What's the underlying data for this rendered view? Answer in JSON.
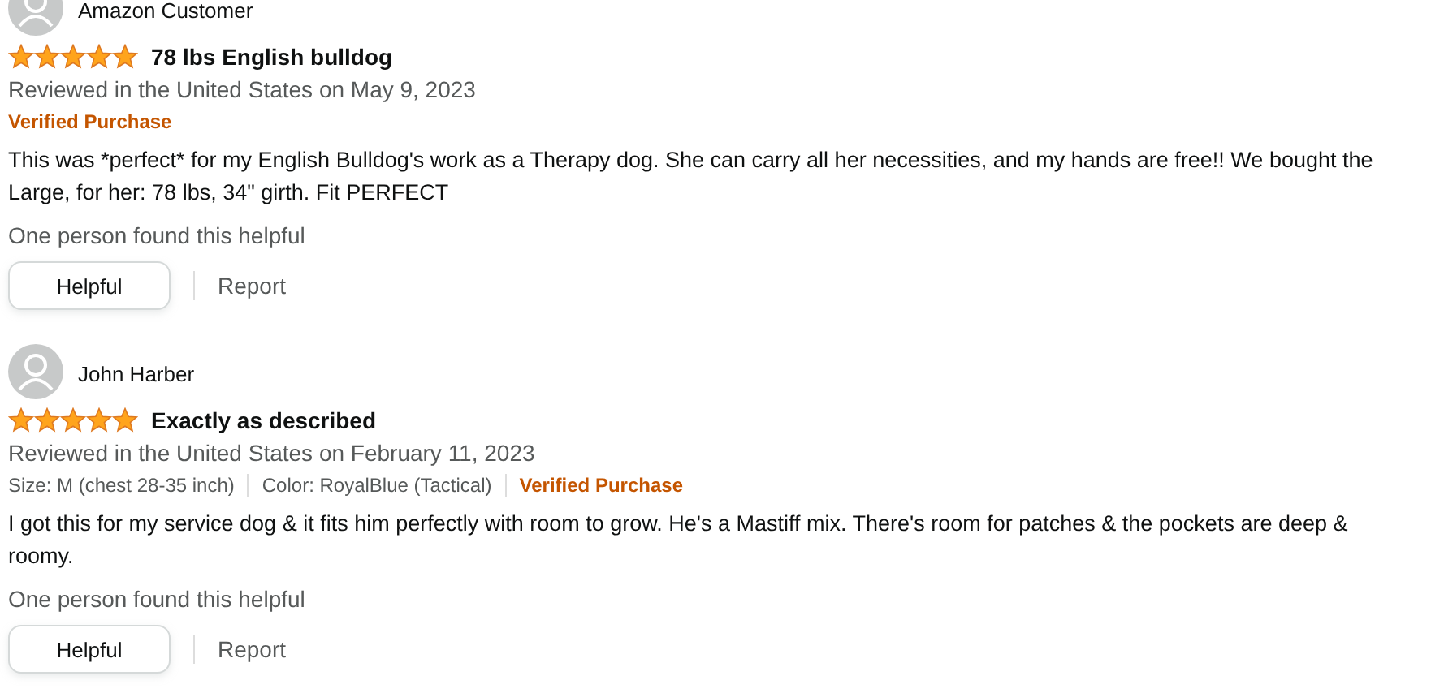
{
  "reviews": [
    {
      "author": "Amazon Customer",
      "stars": 5,
      "title": "78 lbs English bulldog",
      "date": "Reviewed in the United States on May 9, 2023",
      "verified_label": "Verified Purchase",
      "body": "This was *perfect* for my English Bulldog's work as a Therapy dog. She can carry all her necessities, and my hands are free!! We bought the Large, for her: 78 lbs, 34\" girth. Fit PERFECT",
      "helpful_count": "One person found this helpful",
      "helpful_button": "Helpful",
      "report_link": "Report"
    },
    {
      "author": "John Harber",
      "stars": 5,
      "title": "Exactly as described",
      "date": "Reviewed in the United States on February 11, 2023",
      "meta": [
        "Size: M (chest 28-35 inch)",
        "Color: RoyalBlue (Tactical)"
      ],
      "verified_label": "Verified Purchase",
      "body": "I got this for my service dog & it fits him perfectly with room to grow. He's a Mastiff mix. There's room for patches & the pockets are deep & roomy.",
      "helpful_count": "One person found this helpful",
      "helpful_button": "Helpful",
      "report_link": "Report"
    }
  ]
}
